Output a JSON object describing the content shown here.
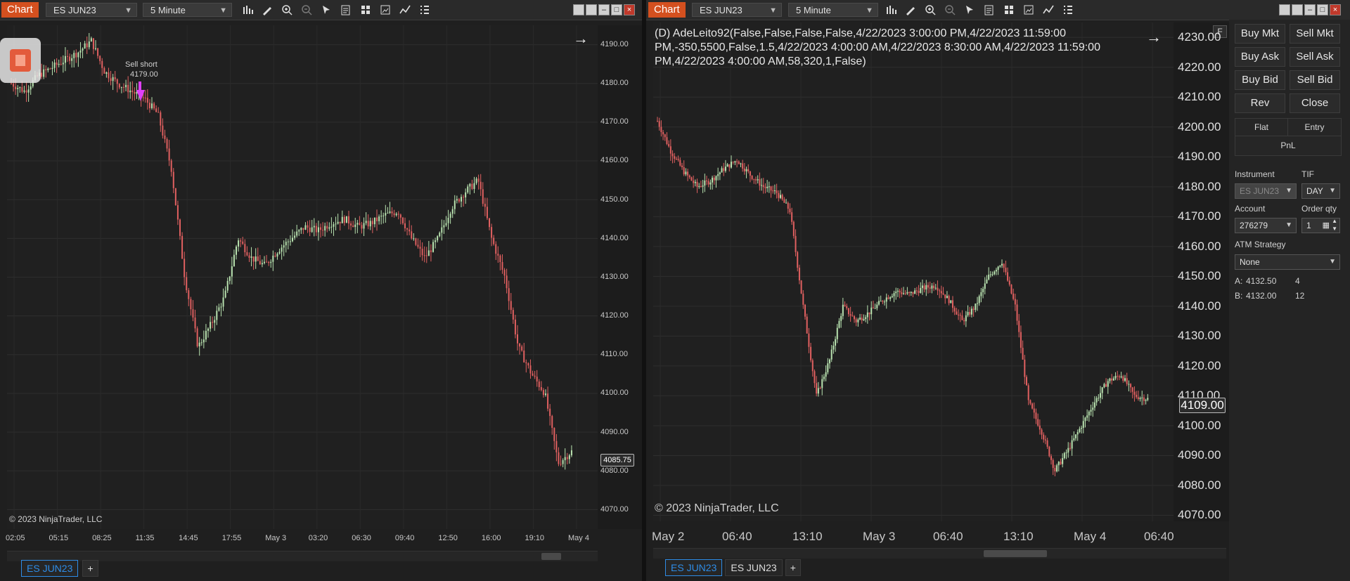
{
  "left_chart": {
    "tab_label": "Chart",
    "instrument": "ES JUN23",
    "interval": "5 Minute",
    "y_ticks": [
      "4190.00",
      "4180.00",
      "4170.00",
      "4160.00",
      "4150.00",
      "4140.00",
      "4130.00",
      "4120.00",
      "4110.00",
      "4100.00",
      "4090.00",
      "4080.00",
      "4070.00"
    ],
    "x_ticks": [
      "02:05",
      "05:15",
      "08:25",
      "11:35",
      "14:45",
      "17:55",
      "May 3",
      "03:20",
      "06:30",
      "09:40",
      "12:50",
      "16:00",
      "19:10",
      "May 4"
    ],
    "last_price": "4085.75",
    "trade_marker_line1": "Sell short",
    "trade_marker_line2": "4179.00",
    "copyright": "© 2023 NinjaTrader, LLC",
    "bottom_tab": "ES JUN23",
    "add_tab": "+"
  },
  "right_chart": {
    "tab_label": "Chart",
    "instrument": "ES JUN23",
    "interval": "5 Minute",
    "indicator_line1": "(D) AdeLeito92(False,False,False,False,4/22/2023 3:00:00 PM,4/22/2023 11:59:00",
    "indicator_line2": "PM,-350,5500,False,1.5,4/22/2023 4:00:00 AM,4/22/2023 8:30:00 AM,4/22/2023 11:59:00",
    "indicator_line3": "PM,4/22/2023 4:00:00 AM,58,320,1,False)",
    "y_ticks": [
      "4230.00",
      "4220.00",
      "4210.00",
      "4200.00",
      "4190.00",
      "4180.00",
      "4170.00",
      "4160.00",
      "4150.00",
      "4140.00",
      "4130.00",
      "4120.00",
      "4110.00",
      "4100.00",
      "4090.00",
      "4080.00",
      "4070.00"
    ],
    "x_ticks": [
      "May 2",
      "06:40",
      "13:10",
      "May 3",
      "06:40",
      "13:10",
      "May 4",
      "06:40"
    ],
    "last_price": "4109.00",
    "copyright": "© 2023 NinjaTrader, LLC",
    "bottom_tab_1": "ES JUN23",
    "bottom_tab_2": "ES JUN23",
    "add_tab": "+",
    "f_button": "F"
  },
  "order_panel": {
    "buy_mkt": "Buy Mkt",
    "sell_mkt": "Sell Mkt",
    "buy_ask": "Buy Ask",
    "sell_ask": "Sell Ask",
    "buy_bid": "Buy Bid",
    "sell_bid": "Sell Bid",
    "rev": "Rev",
    "close": "Close",
    "flat": "Flat",
    "entry": "Entry",
    "pnl": "PnL",
    "instrument_label": "Instrument",
    "tif_label": "TIF",
    "instrument_value": "ES JUN23",
    "tif_value": "DAY",
    "account_label": "Account",
    "order_qty_label": "Order qty",
    "account_value": "276279",
    "order_qty_value": "1",
    "atm_label": "ATM Strategy",
    "atm_value": "None",
    "ask_label": "A:",
    "ask_price": "4132.50",
    "ask_size": "4",
    "bid_label": "B:",
    "bid_price": "4132.00",
    "bid_size": "12"
  },
  "colors": {
    "up": "#b9e3b0",
    "down": "#e06060",
    "marker": "#e040fb",
    "accent": "#d4501f",
    "active_tab": "#2e8ce6"
  },
  "chart_data": [
    {
      "type": "candlestick",
      "ylim": [
        4065,
        4195
      ],
      "x_ticks": [
        "02:05",
        "05:15",
        "08:25",
        "11:35",
        "14:45",
        "17:55",
        "May 3",
        "03:20",
        "06:30",
        "09:40",
        "12:50",
        "16:00",
        "19:10",
        "May 4"
      ],
      "y": [
        4180,
        4178,
        4182,
        4184,
        4186,
        4188,
        4191,
        4183,
        4180,
        4178,
        4176,
        4172,
        4158,
        4130,
        4112,
        4118,
        4125,
        4140,
        4135,
        4133,
        4137,
        4140,
        4143,
        4142,
        4144,
        4145,
        4143,
        4144,
        4146,
        4147,
        4140,
        4135,
        4140,
        4148,
        4152,
        4155,
        4140,
        4130,
        4112,
        4105,
        4100,
        4082,
        4085
      ],
      "last_price": 4085.75,
      "annotations": [
        "Sell short",
        "4179.00"
      ]
    },
    {
      "type": "candlestick",
      "ylim": [
        4068,
        4235
      ],
      "x_ticks": [
        "May 2",
        "06:40",
        "13:10",
        "May 3",
        "06:40",
        "13:10",
        "May 4",
        "06:40"
      ],
      "y": [
        4202,
        4192,
        4185,
        4180,
        4182,
        4186,
        4189,
        4184,
        4180,
        4178,
        4172,
        4140,
        4110,
        4122,
        4140,
        4135,
        4138,
        4142,
        4145,
        4144,
        4146,
        4147,
        4142,
        4135,
        4140,
        4150,
        4155,
        4140,
        4108,
        4098,
        4085,
        4092,
        4100,
        4108,
        4115,
        4117,
        4110,
        4109
      ],
      "last_price": 4109.0
    }
  ]
}
